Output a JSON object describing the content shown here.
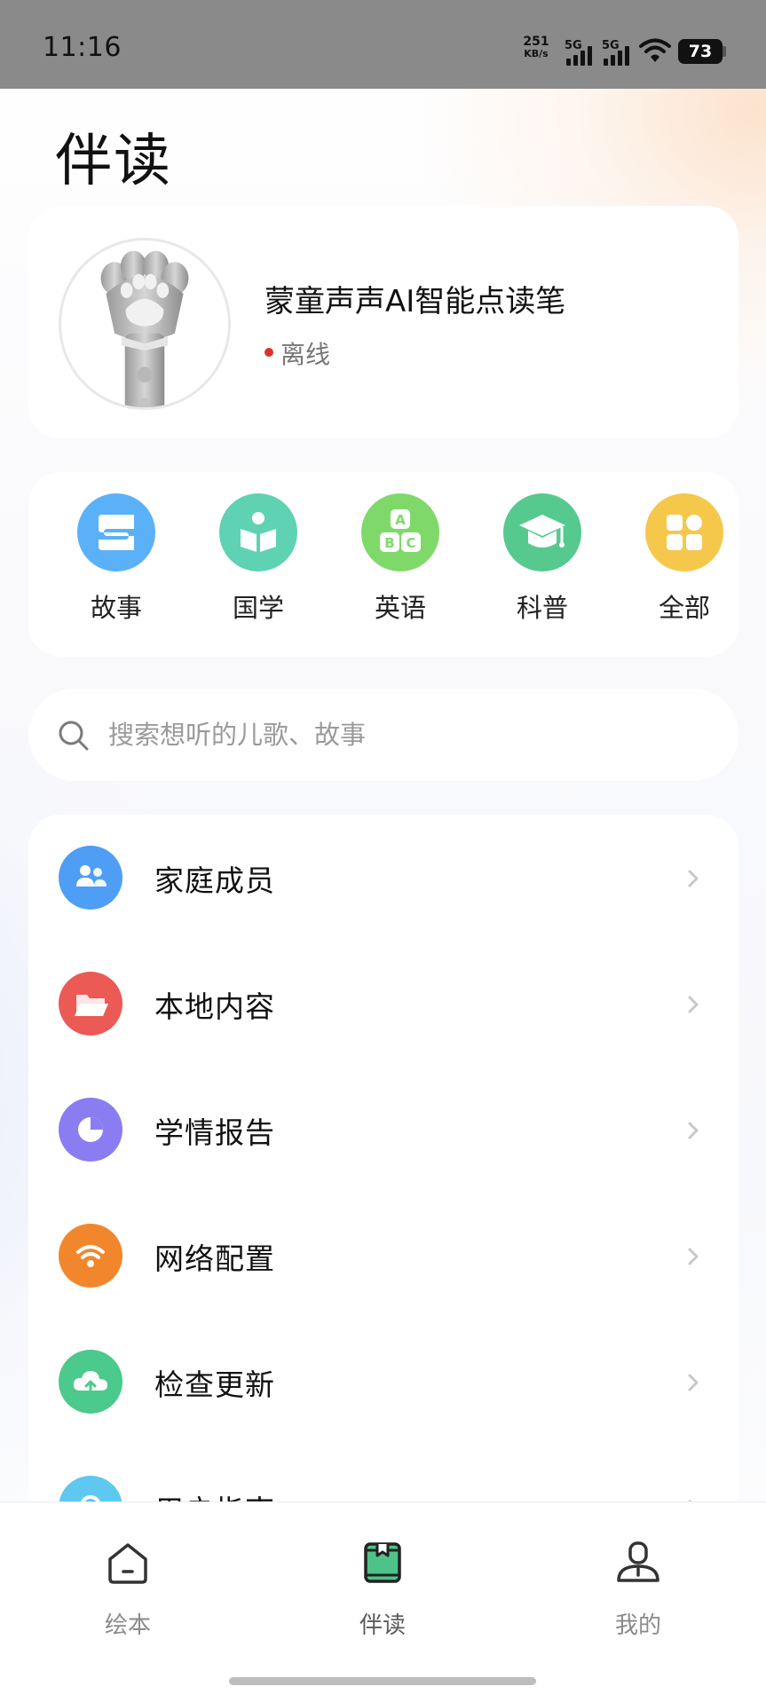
{
  "status_bar": {
    "time": "11:16",
    "net_speed_value": "251",
    "net_speed_unit": "KB/s",
    "signal_1_label": "5G",
    "signal_2_label": "5G",
    "battery": "73"
  },
  "page": {
    "title": "伴读"
  },
  "device": {
    "name": "蒙童声声AI智能点读笔",
    "status": "离线",
    "status_color": "#e0302a"
  },
  "categories": [
    {
      "label": "故事",
      "icon": "story-icon",
      "color": "#5ab1f7"
    },
    {
      "label": "国学",
      "icon": "book-reader-icon",
      "color": "#5fd2b3"
    },
    {
      "label": "英语",
      "icon": "abc-blocks-icon",
      "color": "#7fd96a"
    },
    {
      "label": "科普",
      "icon": "graduation-cap-icon",
      "color": "#56c98f"
    },
    {
      "label": "全部",
      "icon": "grid-icon",
      "color": "#f5c84c"
    }
  ],
  "search": {
    "placeholder": "搜索想听的儿歌、故事",
    "value": ""
  },
  "menu": [
    {
      "label": "家庭成员",
      "icon": "family-icon",
      "color": "#4f9ef5"
    },
    {
      "label": "本地内容",
      "icon": "folder-icon",
      "color": "#eb5a54"
    },
    {
      "label": "学情报告",
      "icon": "pie-chart-icon",
      "color": "#8a7df2"
    },
    {
      "label": "网络配置",
      "icon": "wifi-icon",
      "color": "#f2862c"
    },
    {
      "label": "检查更新",
      "icon": "cloud-upload-icon",
      "color": "#4cc98c"
    },
    {
      "label": "用户指南",
      "icon": "guide-icon",
      "color": "#5ec8f0"
    }
  ],
  "bottom_nav": [
    {
      "label": "绘本",
      "icon": "home-icon",
      "active": false
    },
    {
      "label": "伴读",
      "icon": "reading-book-icon",
      "active": true
    },
    {
      "label": "我的",
      "icon": "profile-icon",
      "active": false
    }
  ],
  "colors": {
    "accent_green": "#4fc28a",
    "text_primary": "#111111",
    "text_secondary": "#8a8a8a"
  }
}
